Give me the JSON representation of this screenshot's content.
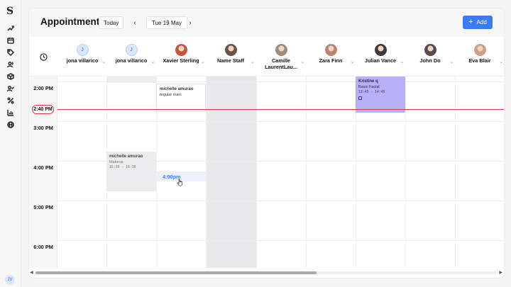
{
  "app": {
    "logo": "S",
    "user_initials": "JV"
  },
  "header": {
    "title": "Appointments",
    "today_label": "Today",
    "prev_label": "‹",
    "next_label": "›",
    "date_label": "Tue 19 May",
    "add_label": "Add",
    "add_icon": "+"
  },
  "staff": [
    {
      "name": "jona villarico",
      "initial": "J",
      "avatar": "initial"
    },
    {
      "name": "jona villarico",
      "initial": "J",
      "avatar": "initial"
    },
    {
      "name": "Xavier Sterling",
      "avatar": "photo",
      "color": "#c7553f"
    },
    {
      "name": "Name Staff",
      "avatar": "photo",
      "color": "#6a5548"
    },
    {
      "name": "Camille LaurentLau...",
      "avatar": "photo",
      "color": "#9d8c80"
    },
    {
      "name": "Zara Finn",
      "avatar": "photo",
      "color": "#b78572"
    },
    {
      "name": "Julian Vance",
      "avatar": "photo",
      "color": "#3f3a3b"
    },
    {
      "name": "John Do",
      "avatar": "photo",
      "color": "#5a4a52"
    },
    {
      "name": "Eva Blair",
      "avatar": "photo",
      "color": "#caa08a"
    }
  ],
  "times": [
    "2:00 PM",
    "3:00 PM",
    "4:00 PM",
    "5:00 PM",
    "6:00 PM"
  ],
  "current_time": "2:40 PM",
  "appointments": [
    {
      "client": "michelle amurao",
      "service": "regular mani",
      "time": ""
    },
    {
      "client": "michelle amurao",
      "service": "Makeup",
      "time": "15:30 - 16:30"
    },
    {
      "client": "Kristine q",
      "service": "Basic Facial",
      "time": "13:45 - 14:45"
    }
  ],
  "hover_slot_label": "4:00pm",
  "colors": {
    "accent": "#3b7cf2",
    "now": "#e0353b",
    "appt_purple": "#b6b0f6"
  }
}
